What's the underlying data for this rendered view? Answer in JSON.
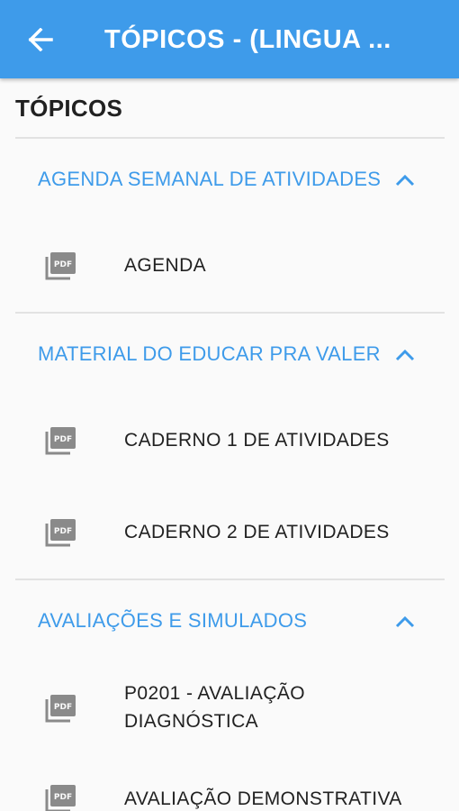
{
  "appbar": {
    "title": "TÓPICOS - (LINGUA ..."
  },
  "page": {
    "heading": "TÓPICOS"
  },
  "groups": [
    {
      "title": "AGENDA SEMANAL DE ATIVIDADES",
      "items": [
        {
          "label": "AGENDA",
          "icon": "pdf-icon"
        }
      ]
    },
    {
      "title": "MATERIAL DO EDUCAR PRA VALER",
      "items": [
        {
          "label": "CADERNO 1 DE ATIVIDADES",
          "icon": "pdf-icon"
        },
        {
          "label": "CADERNO 2 DE ATIVIDADES",
          "icon": "pdf-icon"
        }
      ]
    },
    {
      "title": "AVALIAÇÕES E SIMULADOS",
      "items": [
        {
          "label": "P0201 - AVALIAÇÃO DIAGNÓSTICA",
          "icon": "pdf-icon"
        },
        {
          "label": "AVALIAÇÃO DEMONSTRATIVA",
          "icon": "pdf-icon"
        }
      ]
    }
  ],
  "colors": {
    "primary": "#3e9bea",
    "text": "#212121",
    "icon": "#8a8a8a",
    "divider": "#e2e2e2",
    "background": "#fafafa"
  }
}
